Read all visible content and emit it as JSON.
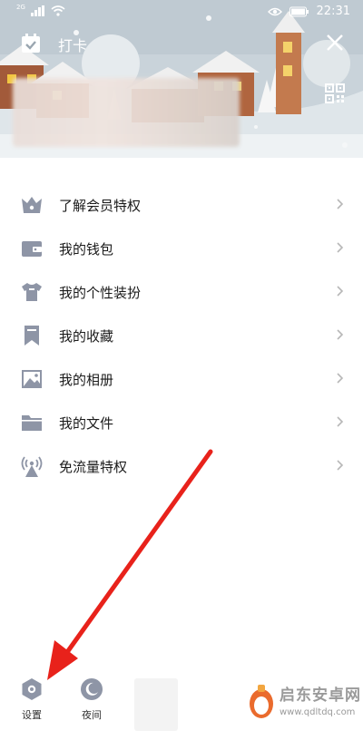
{
  "status_bar": {
    "network": "2G",
    "time": "22:31",
    "icons": [
      "signal-icon",
      "wifi-icon",
      "eye-icon",
      "battery-icon"
    ]
  },
  "header": {
    "checkin_label": "打卡",
    "icons": [
      "calendar-check-icon",
      "close-icon",
      "qr-code-icon"
    ]
  },
  "menu": {
    "items": [
      {
        "label": "了解会员特权",
        "icon": "crown-icon"
      },
      {
        "label": "我的钱包",
        "icon": "wallet-icon"
      },
      {
        "label": "我的个性装扮",
        "icon": "tshirt-icon"
      },
      {
        "label": "我的收藏",
        "icon": "bookmark-icon"
      },
      {
        "label": "我的相册",
        "icon": "image-icon"
      },
      {
        "label": "我的文件",
        "icon": "folder-icon"
      },
      {
        "label": "免流量特权",
        "icon": "broadcast-icon"
      }
    ]
  },
  "bottom_bar": {
    "settings_label": "设置",
    "night_label": "夜间"
  },
  "watermark": {
    "name": "启东安卓网",
    "url": "www.qdltdq.com"
  },
  "colors": {
    "icon_gray": "#8e95a6",
    "arrow_red": "#e8221b",
    "text_dark": "#1b1b1b"
  }
}
